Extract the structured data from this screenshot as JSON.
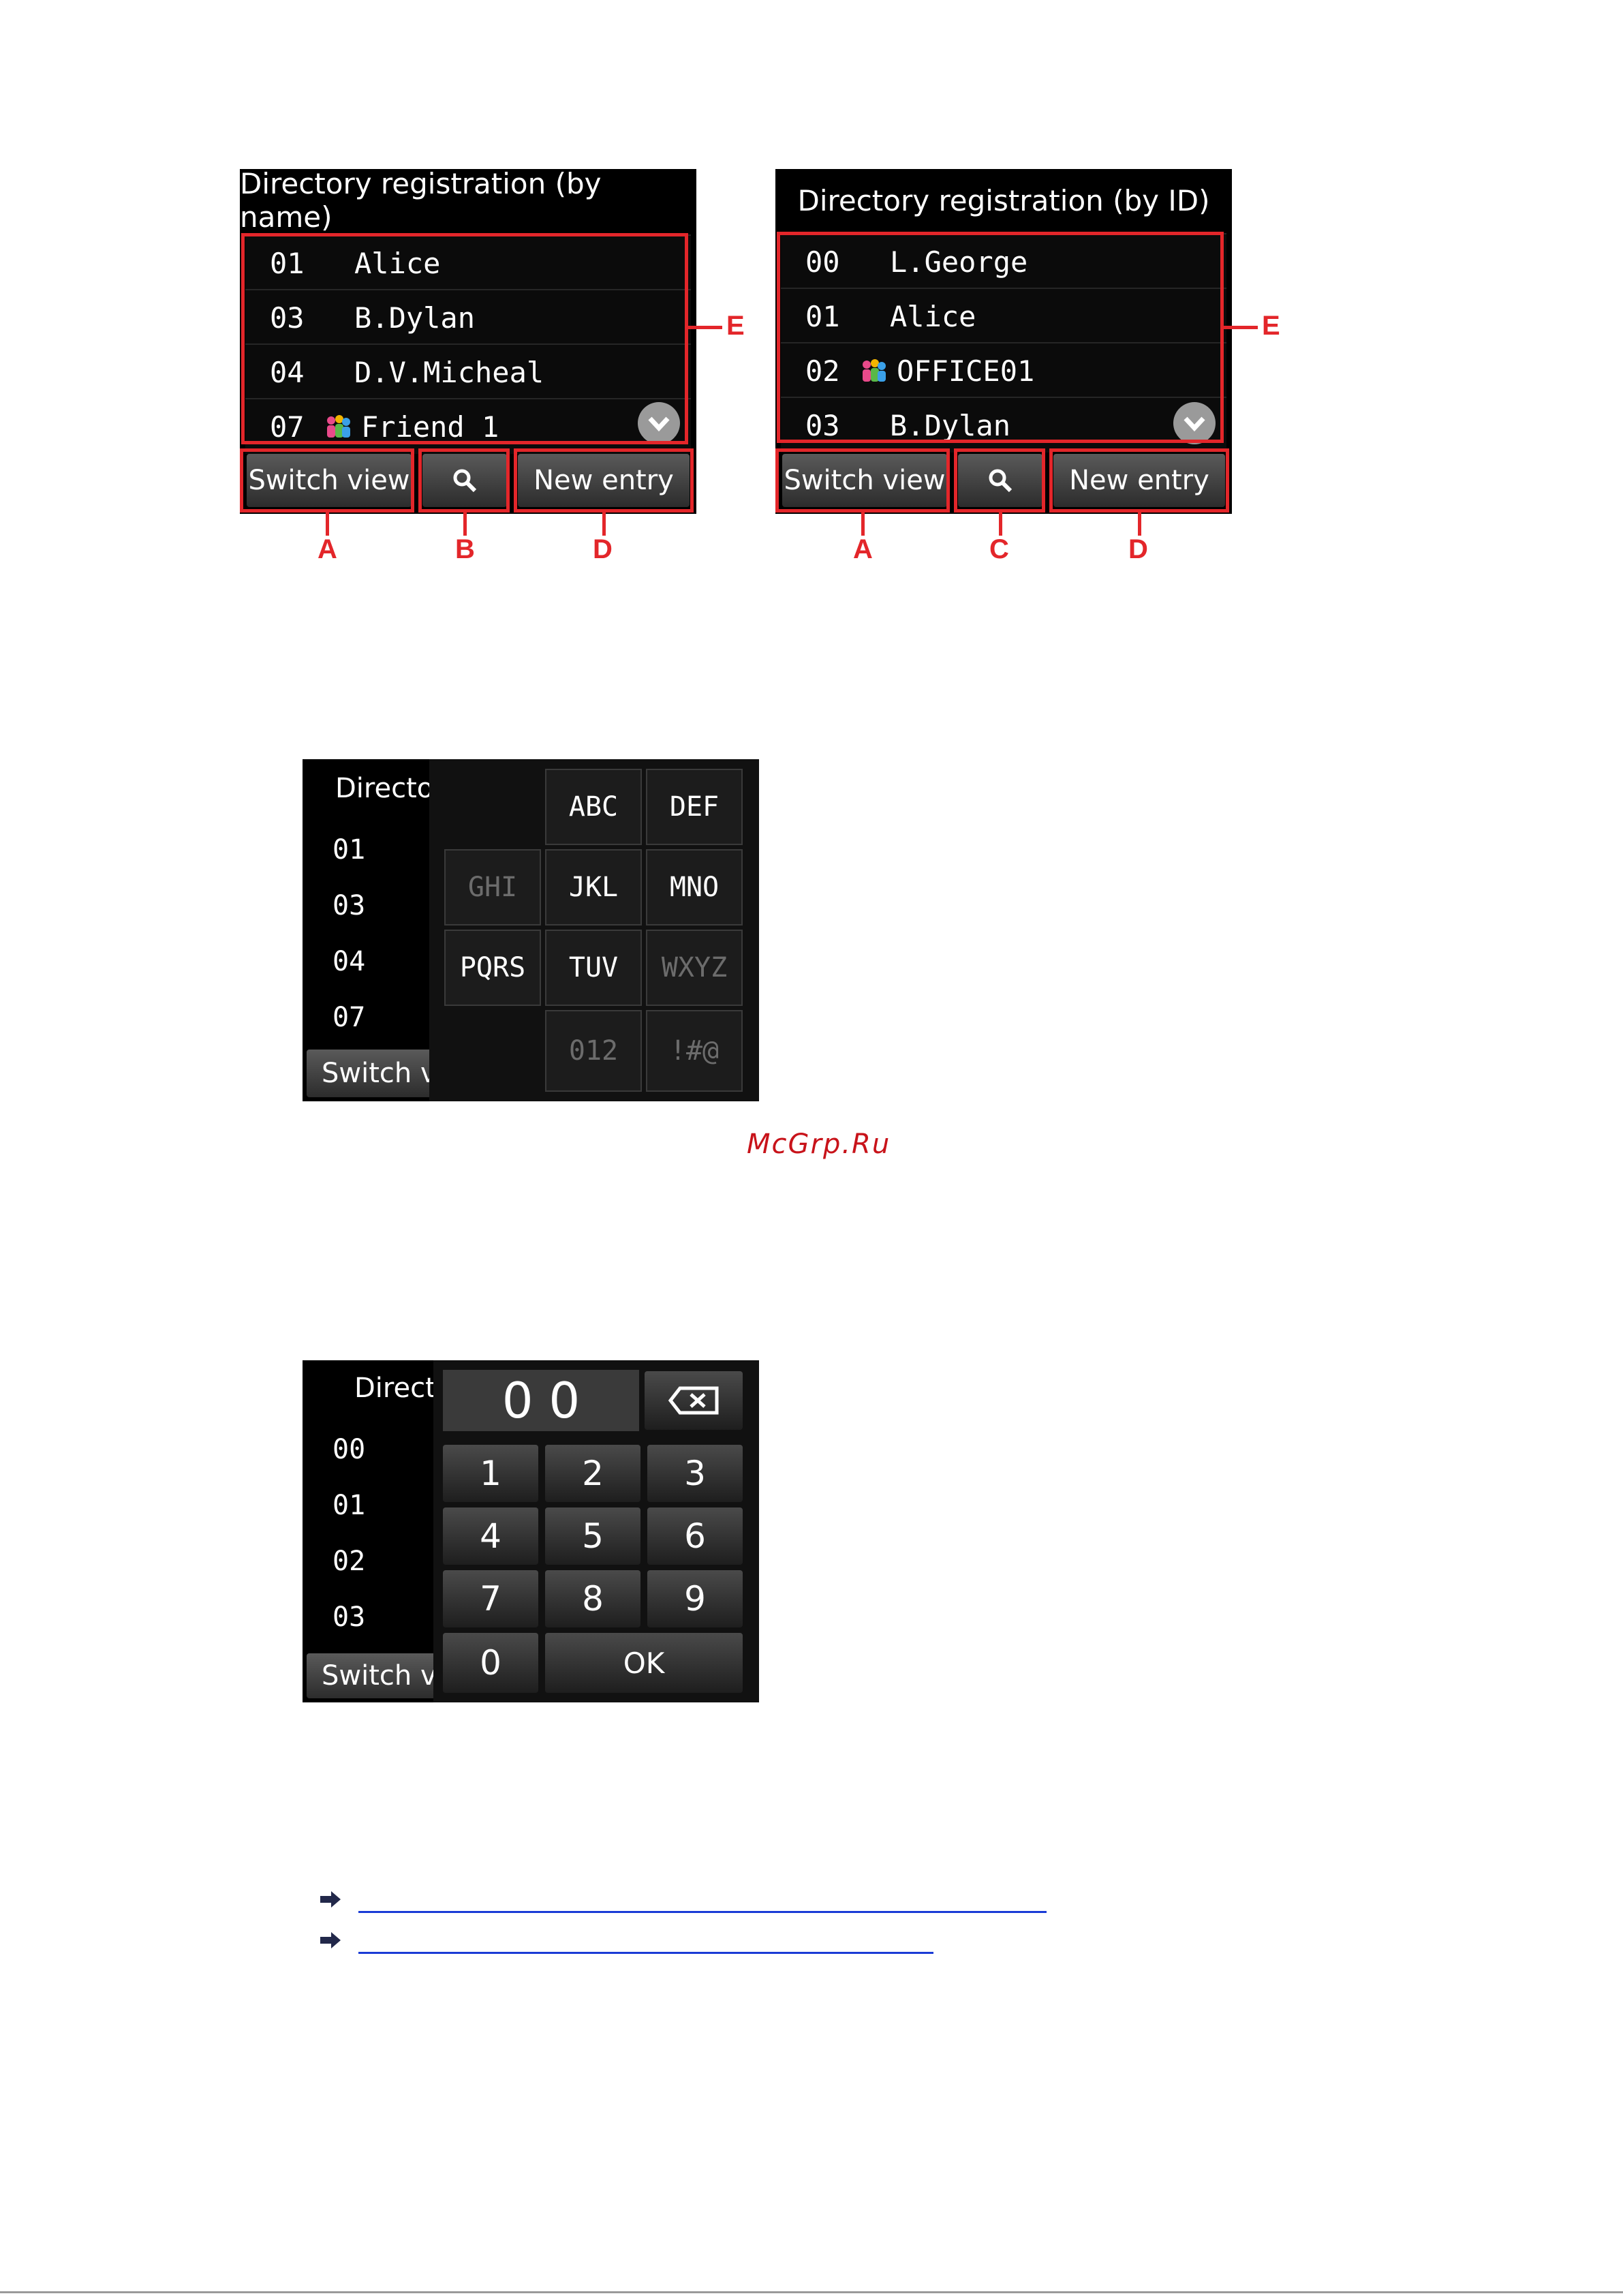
{
  "screen_name": {
    "title": "Directory registration (by name)",
    "rows": [
      {
        "id": "01",
        "name": "Alice",
        "group": false
      },
      {
        "id": "03",
        "name": "B.Dylan",
        "group": false
      },
      {
        "id": "04",
        "name": "D.V.Micheal",
        "group": false
      },
      {
        "id": "07",
        "name": "Friend 1",
        "group": true
      }
    ],
    "buttons": {
      "switch": "Switch view",
      "new": "New entry"
    },
    "callouts": {
      "list": "E",
      "switch": "A",
      "search": "B",
      "new": "D"
    }
  },
  "screen_id": {
    "title": "Directory registration (by ID)",
    "rows": [
      {
        "id": "00",
        "name": "L.George",
        "group": false
      },
      {
        "id": "01",
        "name": "Alice",
        "group": false
      },
      {
        "id": "02",
        "name": "OFFICE01",
        "group": true
      },
      {
        "id": "03",
        "name": "B.Dylan",
        "group": false
      }
    ],
    "buttons": {
      "switch": "Switch view",
      "new": "New entry"
    },
    "callouts": {
      "list": "E",
      "switch": "A",
      "search": "C",
      "new": "D"
    }
  },
  "keypad_letters": {
    "title_partial": "Director",
    "row_ids": [
      "01",
      "03",
      "04",
      "07"
    ],
    "switch_partial": "Switch vi",
    "keys": [
      "ABC",
      "DEF",
      "GHI",
      "JKL",
      "MNO",
      "PQRS",
      "TUV",
      "WXYZ",
      "012",
      "!#@"
    ]
  },
  "keypad_numbers": {
    "title_partial": "Direct",
    "row_ids": [
      "00",
      "01",
      "02",
      "03"
    ],
    "switch_partial": "Switch vi",
    "display": "0 0",
    "digits": [
      "1",
      "2",
      "3",
      "4",
      "5",
      "6",
      "7",
      "8",
      "9",
      "0"
    ],
    "ok": "OK"
  },
  "watermark": "McGrp.Ru",
  "colors": {
    "callout": "#e3262a",
    "link": "#1a3bd6",
    "screen": "#000000"
  }
}
